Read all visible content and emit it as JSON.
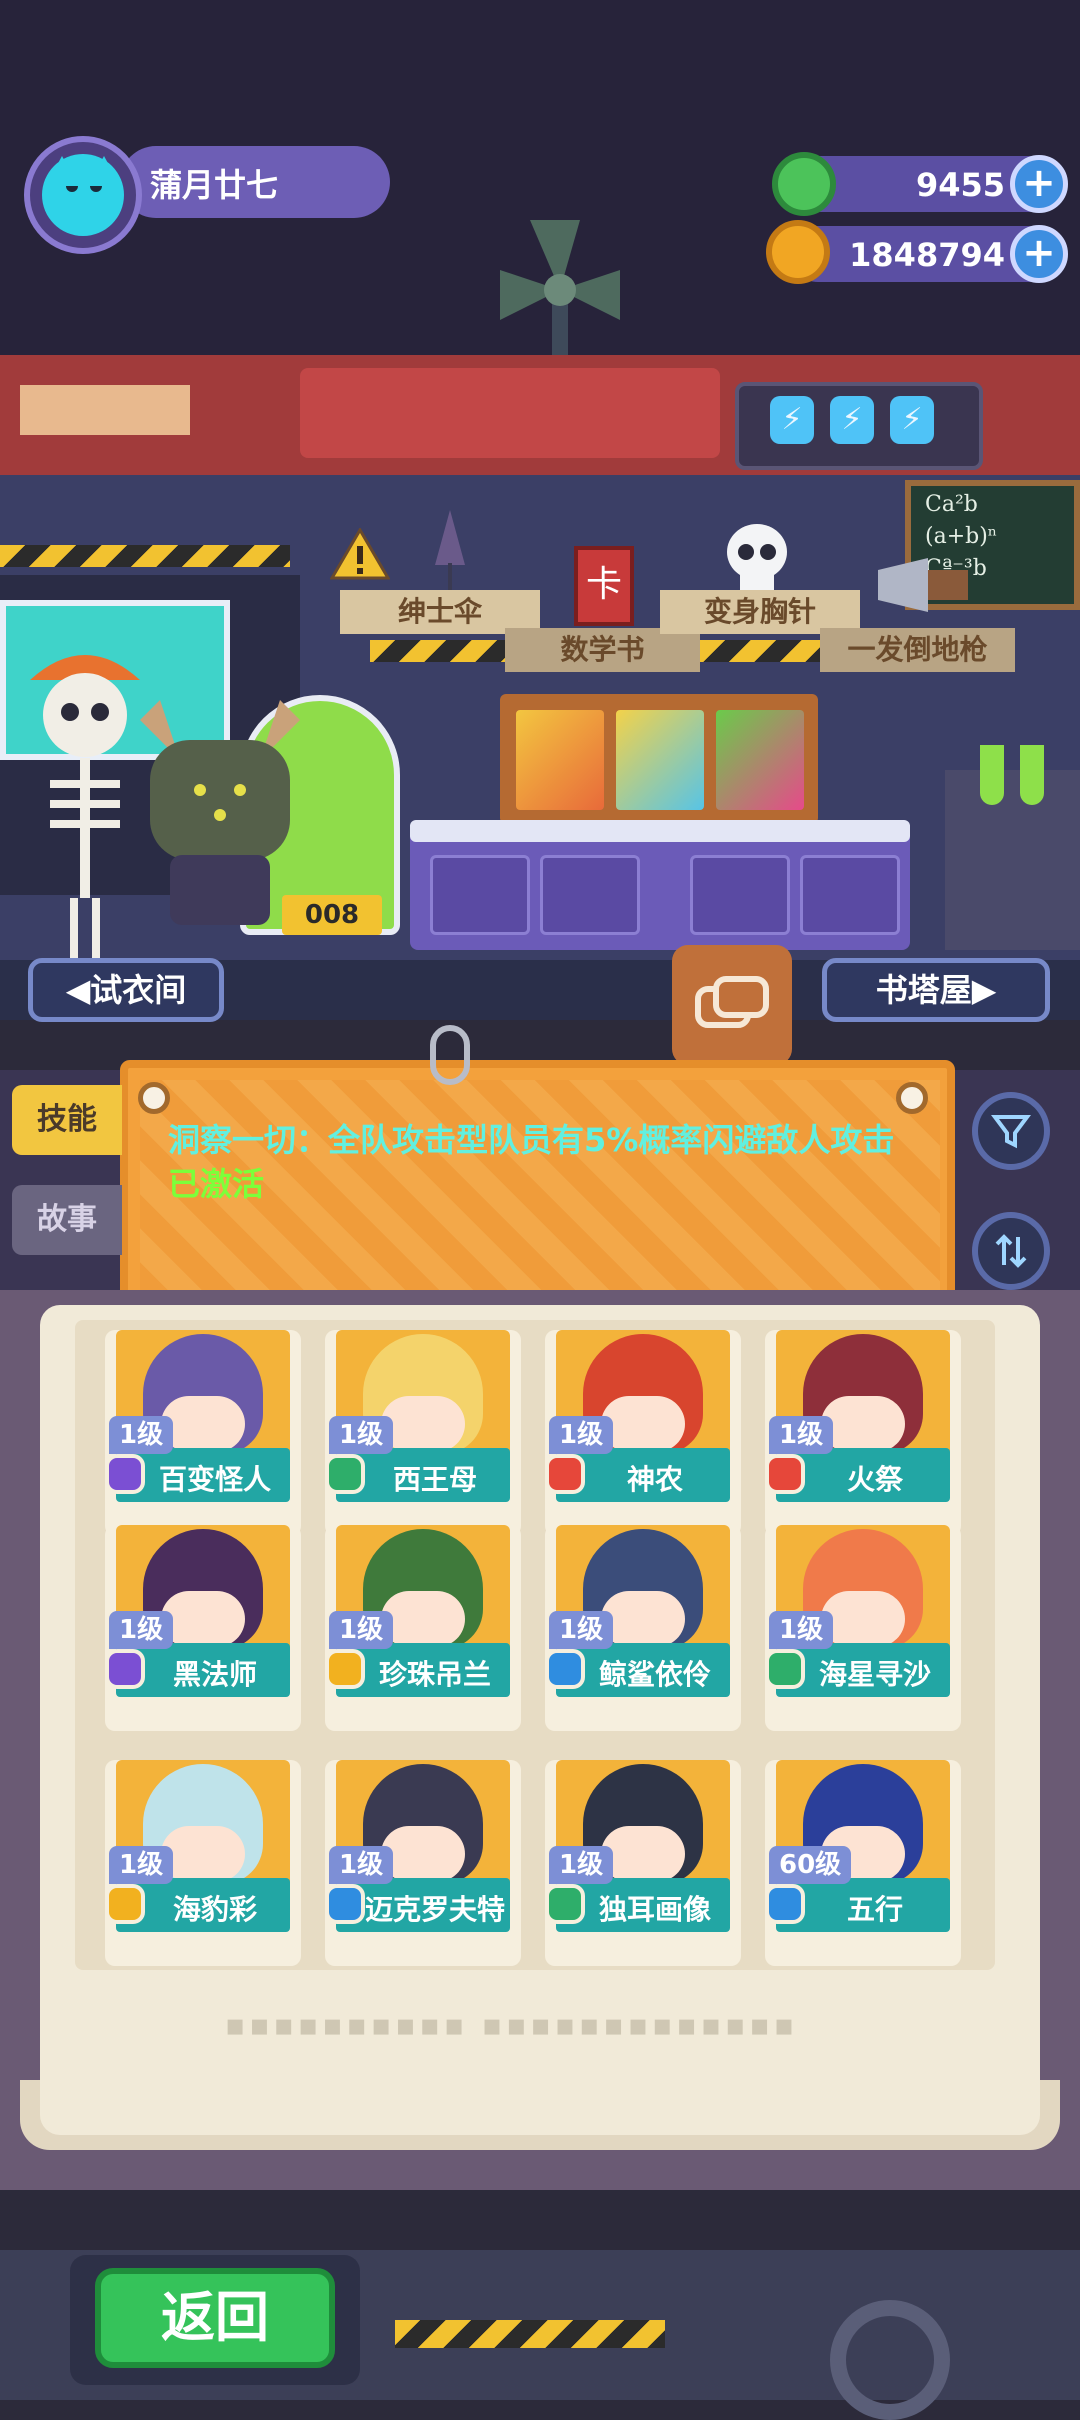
{
  "player": {
    "name": "蒲月廿七",
    "avatar_icon": "cat-avatar-icon"
  },
  "currencies": [
    {
      "name": "gem",
      "value": "9455",
      "icon": "green-gem-icon",
      "color": "#4cc35a"
    },
    {
      "name": "coin",
      "value": "1848794",
      "icon": "gold-planet-coin-icon",
      "color": "#f1a623"
    }
  ],
  "lab": {
    "items": [
      "绅士伞",
      "数学书",
      "变身胸针",
      "一发倒地枪"
    ],
    "machine_number": "008",
    "chalkboard": [
      "Ca²b",
      "(a+b)ⁿ",
      "Cª⁻³b"
    ],
    "battery_icon": "lightning-bolt-icon"
  },
  "nav": {
    "left": "◀试衣间",
    "right": "书塔屋▶"
  },
  "tabs": {
    "skill": "技能",
    "story": "故事"
  },
  "skill": {
    "text": "洞察一切：全队攻击型队员有5%概率闪避敌人攻击",
    "status": "已激活"
  },
  "controls": {
    "filter_icon": "filter-funnel-icon",
    "sort_icon": "sort-swap-icon"
  },
  "characters": [
    {
      "level": "1级",
      "name": "百变怪人",
      "badge_color": "#7b4fd3",
      "hair": "#6a5aa8"
    },
    {
      "level": "1级",
      "name": "西王母",
      "badge_color": "#2eae6a",
      "hair": "#f4d36b"
    },
    {
      "level": "1级",
      "name": "神农",
      "badge_color": "#e6473a",
      "hair": "#d8452e"
    },
    {
      "level": "1级",
      "name": "火祭",
      "badge_color": "#e6473a",
      "hair": "#8e2f3a"
    },
    {
      "level": "1级",
      "name": "黑法师",
      "badge_color": "#7b4fd3",
      "hair": "#4a2d5c"
    },
    {
      "level": "1级",
      "name": "珍珠吊兰",
      "badge_color": "#f2b11f",
      "hair": "#3f7a3b"
    },
    {
      "level": "1级",
      "name": "鲸鲨依伶",
      "badge_color": "#2f8de0",
      "hair": "#3b4d7a"
    },
    {
      "level": "1级",
      "name": "海星寻沙",
      "badge_color": "#2eae6a",
      "hair": "#f07a4a"
    },
    {
      "level": "1级",
      "name": "海豹彩",
      "badge_color": "#f2b11f",
      "hair": "#bfe3ea"
    },
    {
      "level": "1级",
      "name": "迈克罗夫特",
      "badge_color": "#2f8de0",
      "hair": "#3a3a52"
    },
    {
      "level": "1级",
      "name": "独耳画像",
      "badge_color": "#2eae6a",
      "hair": "#2d3345"
    },
    {
      "level": "60级",
      "name": "五行",
      "badge_color": "#2f8de0",
      "hair": "#2b3f9a"
    }
  ],
  "footer": {
    "back": "返回"
  }
}
